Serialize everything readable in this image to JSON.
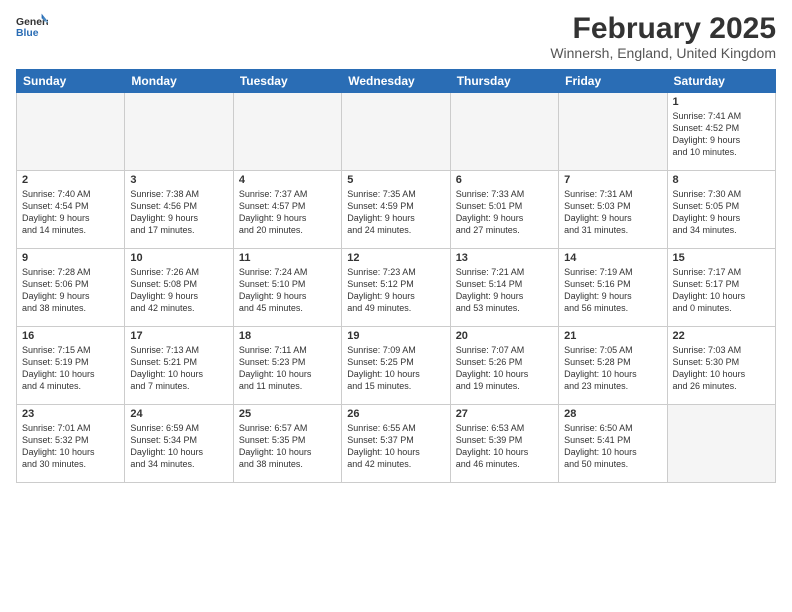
{
  "logo": {
    "line1": "General",
    "line2": "Blue"
  },
  "title": "February 2025",
  "location": "Winnersh, England, United Kingdom",
  "days_of_week": [
    "Sunday",
    "Monday",
    "Tuesday",
    "Wednesday",
    "Thursday",
    "Friday",
    "Saturday"
  ],
  "weeks": [
    [
      {
        "day": "",
        "info": ""
      },
      {
        "day": "",
        "info": ""
      },
      {
        "day": "",
        "info": ""
      },
      {
        "day": "",
        "info": ""
      },
      {
        "day": "",
        "info": ""
      },
      {
        "day": "",
        "info": ""
      },
      {
        "day": "1",
        "info": "Sunrise: 7:41 AM\nSunset: 4:52 PM\nDaylight: 9 hours\nand 10 minutes."
      }
    ],
    [
      {
        "day": "2",
        "info": "Sunrise: 7:40 AM\nSunset: 4:54 PM\nDaylight: 9 hours\nand 14 minutes."
      },
      {
        "day": "3",
        "info": "Sunrise: 7:38 AM\nSunset: 4:56 PM\nDaylight: 9 hours\nand 17 minutes."
      },
      {
        "day": "4",
        "info": "Sunrise: 7:37 AM\nSunset: 4:57 PM\nDaylight: 9 hours\nand 20 minutes."
      },
      {
        "day": "5",
        "info": "Sunrise: 7:35 AM\nSunset: 4:59 PM\nDaylight: 9 hours\nand 24 minutes."
      },
      {
        "day": "6",
        "info": "Sunrise: 7:33 AM\nSunset: 5:01 PM\nDaylight: 9 hours\nand 27 minutes."
      },
      {
        "day": "7",
        "info": "Sunrise: 7:31 AM\nSunset: 5:03 PM\nDaylight: 9 hours\nand 31 minutes."
      },
      {
        "day": "8",
        "info": "Sunrise: 7:30 AM\nSunset: 5:05 PM\nDaylight: 9 hours\nand 34 minutes."
      }
    ],
    [
      {
        "day": "9",
        "info": "Sunrise: 7:28 AM\nSunset: 5:06 PM\nDaylight: 9 hours\nand 38 minutes."
      },
      {
        "day": "10",
        "info": "Sunrise: 7:26 AM\nSunset: 5:08 PM\nDaylight: 9 hours\nand 42 minutes."
      },
      {
        "day": "11",
        "info": "Sunrise: 7:24 AM\nSunset: 5:10 PM\nDaylight: 9 hours\nand 45 minutes."
      },
      {
        "day": "12",
        "info": "Sunrise: 7:23 AM\nSunset: 5:12 PM\nDaylight: 9 hours\nand 49 minutes."
      },
      {
        "day": "13",
        "info": "Sunrise: 7:21 AM\nSunset: 5:14 PM\nDaylight: 9 hours\nand 53 minutes."
      },
      {
        "day": "14",
        "info": "Sunrise: 7:19 AM\nSunset: 5:16 PM\nDaylight: 9 hours\nand 56 minutes."
      },
      {
        "day": "15",
        "info": "Sunrise: 7:17 AM\nSunset: 5:17 PM\nDaylight: 10 hours\nand 0 minutes."
      }
    ],
    [
      {
        "day": "16",
        "info": "Sunrise: 7:15 AM\nSunset: 5:19 PM\nDaylight: 10 hours\nand 4 minutes."
      },
      {
        "day": "17",
        "info": "Sunrise: 7:13 AM\nSunset: 5:21 PM\nDaylight: 10 hours\nand 7 minutes."
      },
      {
        "day": "18",
        "info": "Sunrise: 7:11 AM\nSunset: 5:23 PM\nDaylight: 10 hours\nand 11 minutes."
      },
      {
        "day": "19",
        "info": "Sunrise: 7:09 AM\nSunset: 5:25 PM\nDaylight: 10 hours\nand 15 minutes."
      },
      {
        "day": "20",
        "info": "Sunrise: 7:07 AM\nSunset: 5:26 PM\nDaylight: 10 hours\nand 19 minutes."
      },
      {
        "day": "21",
        "info": "Sunrise: 7:05 AM\nSunset: 5:28 PM\nDaylight: 10 hours\nand 23 minutes."
      },
      {
        "day": "22",
        "info": "Sunrise: 7:03 AM\nSunset: 5:30 PM\nDaylight: 10 hours\nand 26 minutes."
      }
    ],
    [
      {
        "day": "23",
        "info": "Sunrise: 7:01 AM\nSunset: 5:32 PM\nDaylight: 10 hours\nand 30 minutes."
      },
      {
        "day": "24",
        "info": "Sunrise: 6:59 AM\nSunset: 5:34 PM\nDaylight: 10 hours\nand 34 minutes."
      },
      {
        "day": "25",
        "info": "Sunrise: 6:57 AM\nSunset: 5:35 PM\nDaylight: 10 hours\nand 38 minutes."
      },
      {
        "day": "26",
        "info": "Sunrise: 6:55 AM\nSunset: 5:37 PM\nDaylight: 10 hours\nand 42 minutes."
      },
      {
        "day": "27",
        "info": "Sunrise: 6:53 AM\nSunset: 5:39 PM\nDaylight: 10 hours\nand 46 minutes."
      },
      {
        "day": "28",
        "info": "Sunrise: 6:50 AM\nSunset: 5:41 PM\nDaylight: 10 hours\nand 50 minutes."
      },
      {
        "day": "",
        "info": ""
      }
    ]
  ]
}
